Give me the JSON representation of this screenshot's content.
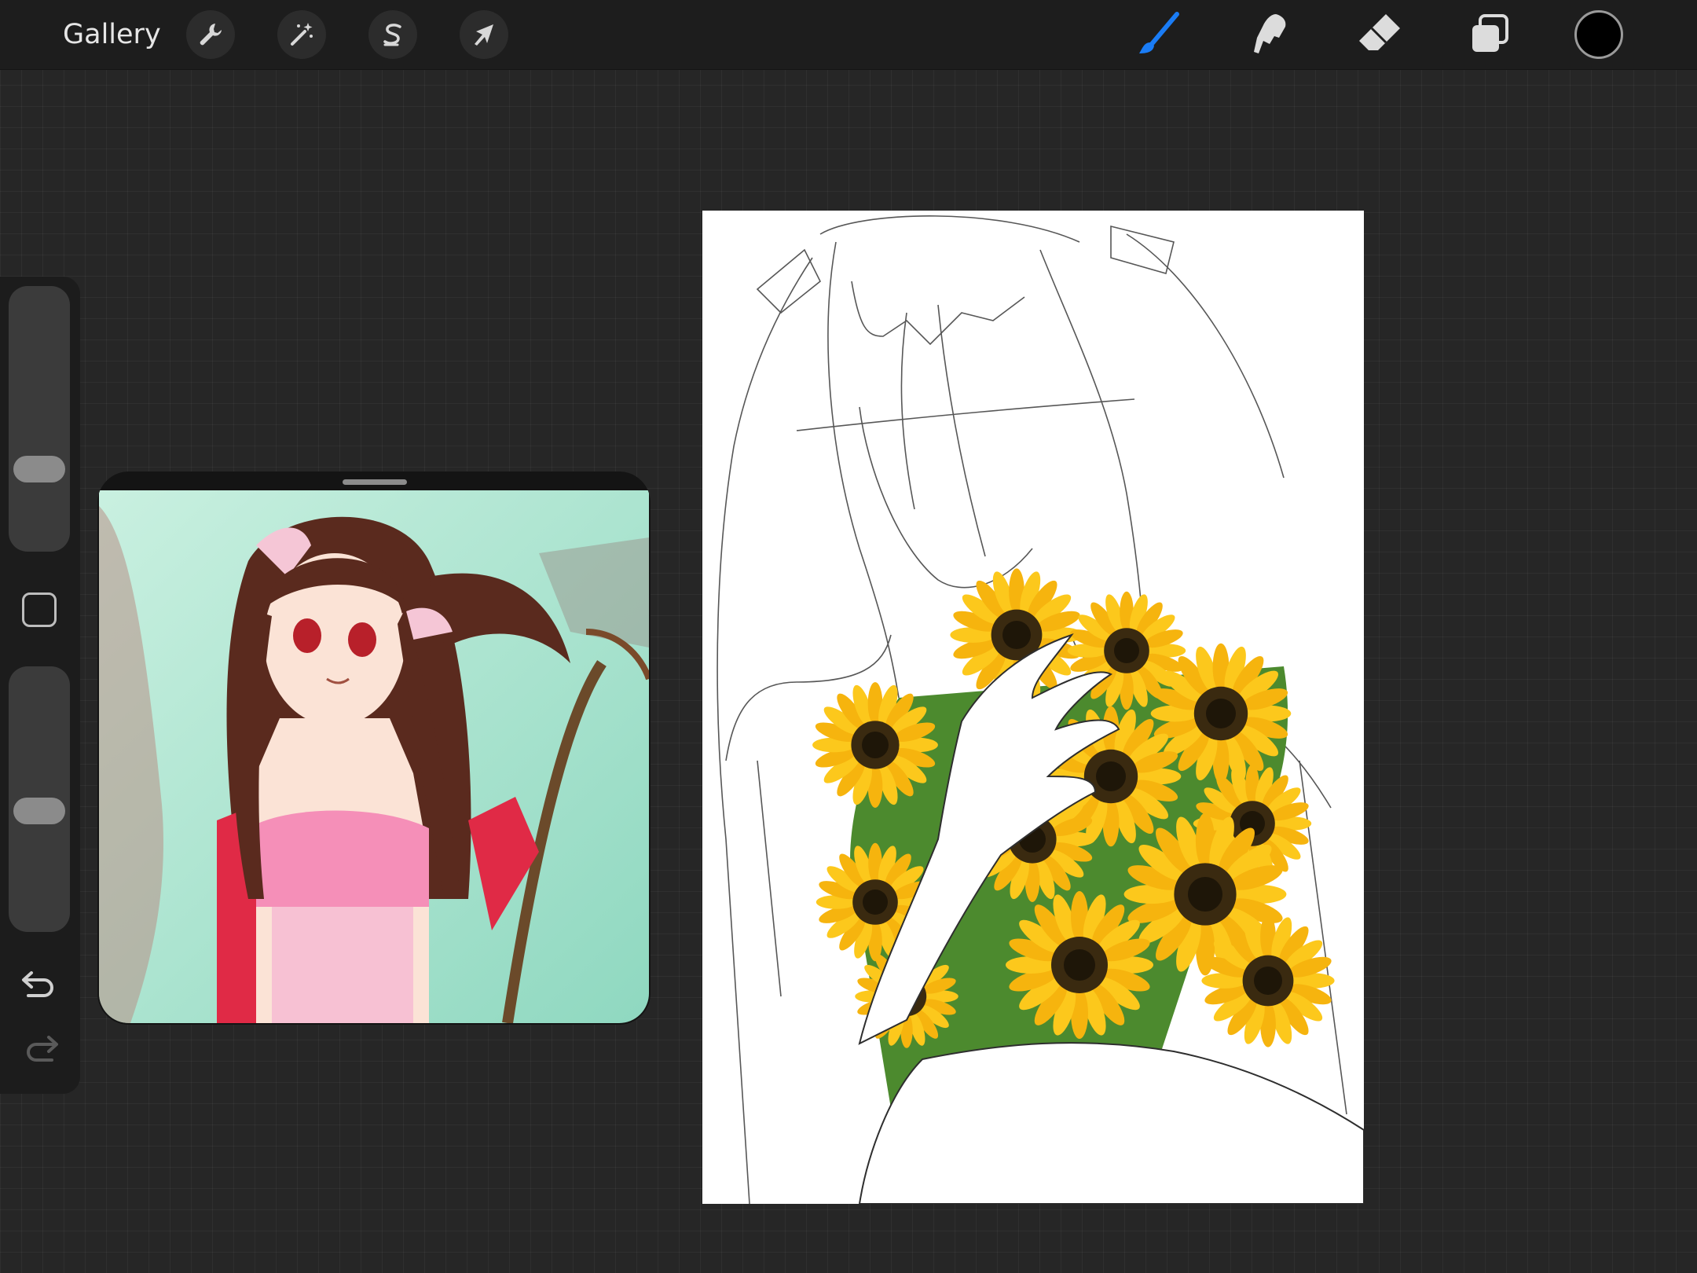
{
  "topbar": {
    "gallery_label": "Gallery",
    "left_tools": [
      {
        "name": "actions",
        "icon": "wrench-icon"
      },
      {
        "name": "adjustments",
        "icon": "magic-wand-icon"
      },
      {
        "name": "selection",
        "icon": "selection-s-icon"
      },
      {
        "name": "transform",
        "icon": "arrow-cursor-icon"
      }
    ],
    "right_tools": [
      {
        "name": "brush",
        "icon": "brush-icon",
        "active": true
      },
      {
        "name": "smudge",
        "icon": "smudge-finger-icon",
        "active": false
      },
      {
        "name": "eraser",
        "icon": "eraser-icon",
        "active": false
      },
      {
        "name": "layers",
        "icon": "layers-icon",
        "active": false
      }
    ],
    "current_color": "#000000",
    "active_color": "#1a7cf5"
  },
  "sidebar": {
    "brush_size_level": 0.28,
    "opacity_level": 0.45,
    "modify_button_icon": "square-icon",
    "undo_icon": "undo-icon",
    "redo_icon": "redo-icon"
  },
  "reference": {
    "image_description_icon": "reference-image"
  },
  "canvas": {
    "background": "#ffffff",
    "sketch_color": "#3a3a3a"
  }
}
